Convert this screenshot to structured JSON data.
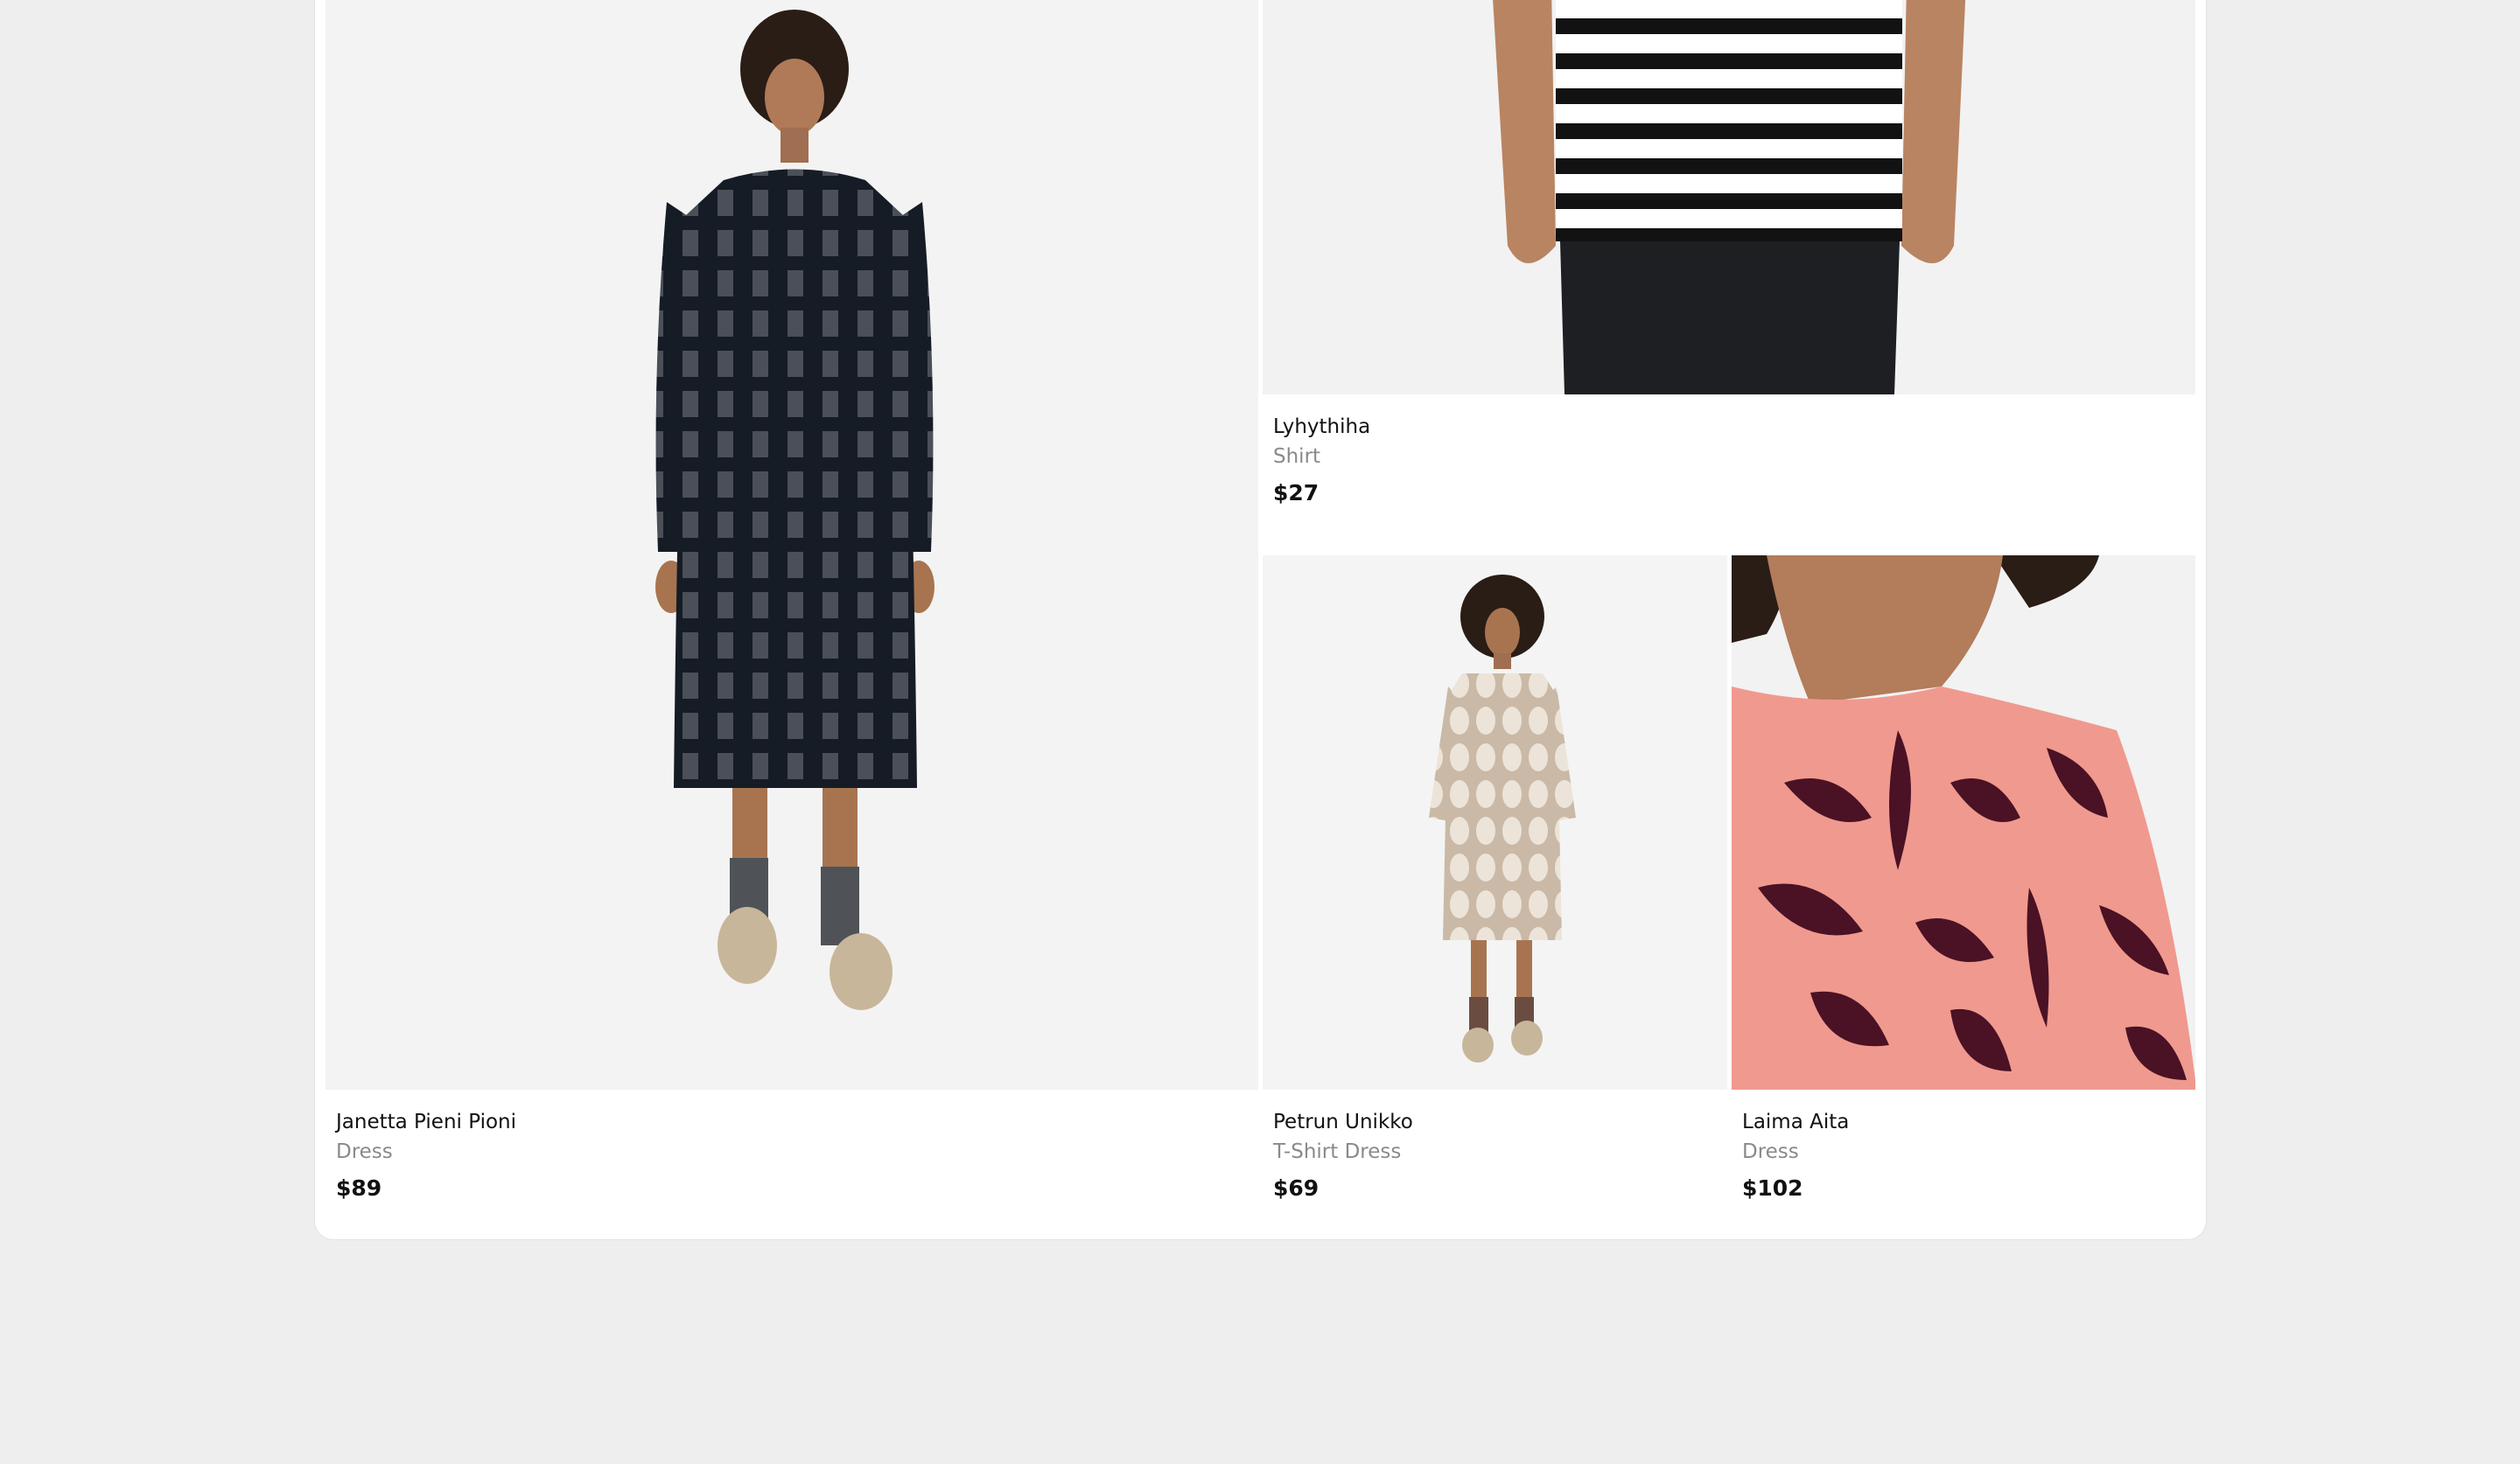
{
  "products": [
    {
      "name": "Janetta Pieni Pioni",
      "category": "Dress",
      "price": "$89",
      "image": "model-knit-dress-dark-checks"
    },
    {
      "name": "Lyhythiha",
      "category": "Shirt",
      "price": "$27",
      "image": "striped-tshirt-closeup"
    },
    {
      "name": "Petrun Unikko",
      "category": "T-Shirt Dress",
      "price": "$69",
      "image": "model-beige-dot-dress"
    },
    {
      "name": "Laima Aita",
      "category": "Dress",
      "price": "$102",
      "image": "pink-floral-top-closeup"
    }
  ],
  "colors": {
    "page_background": "#eeeeee",
    "card_background": "#ffffff",
    "category_text": "#8a8a8a"
  }
}
